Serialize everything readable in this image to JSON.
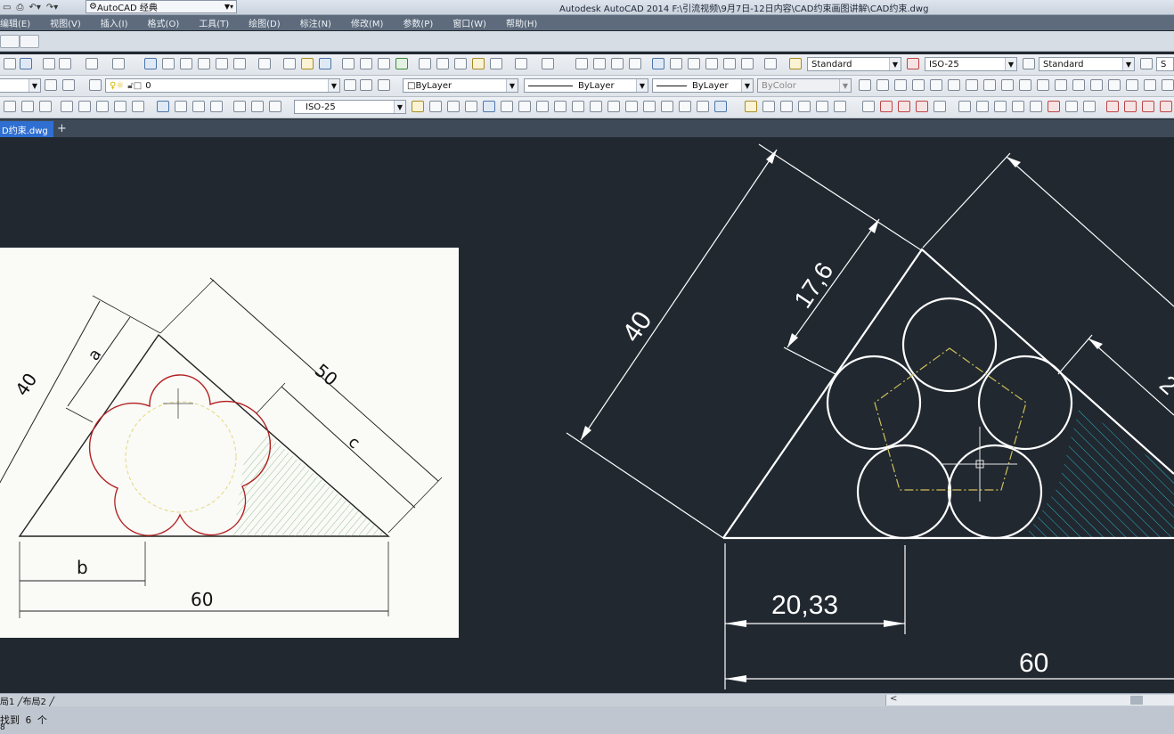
{
  "quick_access": {
    "workspace": "AutoCAD 经典"
  },
  "app_title": "Autodesk AutoCAD 2014    F:\\引流视频\\9月7日-12日内容\\CAD约束画图讲解\\CAD约束.dwg",
  "menu": [
    "编辑(E)",
    "视图(V)",
    "插入(I)",
    "格式(O)",
    "工具(T)",
    "绘图(D)",
    "标注(N)",
    "修改(M)",
    "参数(P)",
    "窗口(W)",
    "帮助(H)"
  ],
  "toolbar1": {
    "text_style": "Standard",
    "dim_style": "ISO-25",
    "table_style": "Standard",
    "extra": "S"
  },
  "toolbar2": {
    "layer": "0",
    "color": "ByLayer",
    "linetype": "ByLayer",
    "lineweight": "ByLayer",
    "plotstyle": "ByColor"
  },
  "toolbar3": {
    "dim_style": "ISO-25"
  },
  "doc_tab": {
    "label": "D约束.dwg",
    "plus": "+"
  },
  "reference_image": {
    "dims": {
      "d40": "40",
      "a": "a",
      "d50": "50",
      "c": "c",
      "b": "b",
      "d60": "60"
    }
  },
  "drawing": {
    "dims": {
      "d40": "40",
      "d17": "17,6",
      "d2": "2",
      "d20": "20,33",
      "d60": "60"
    }
  },
  "layout_tabs": "局1 ╱布局2 ╱",
  "scroll_arrow": "<",
  "command_line": {
    "text": "找到 6 个",
    "prompt": "8"
  }
}
